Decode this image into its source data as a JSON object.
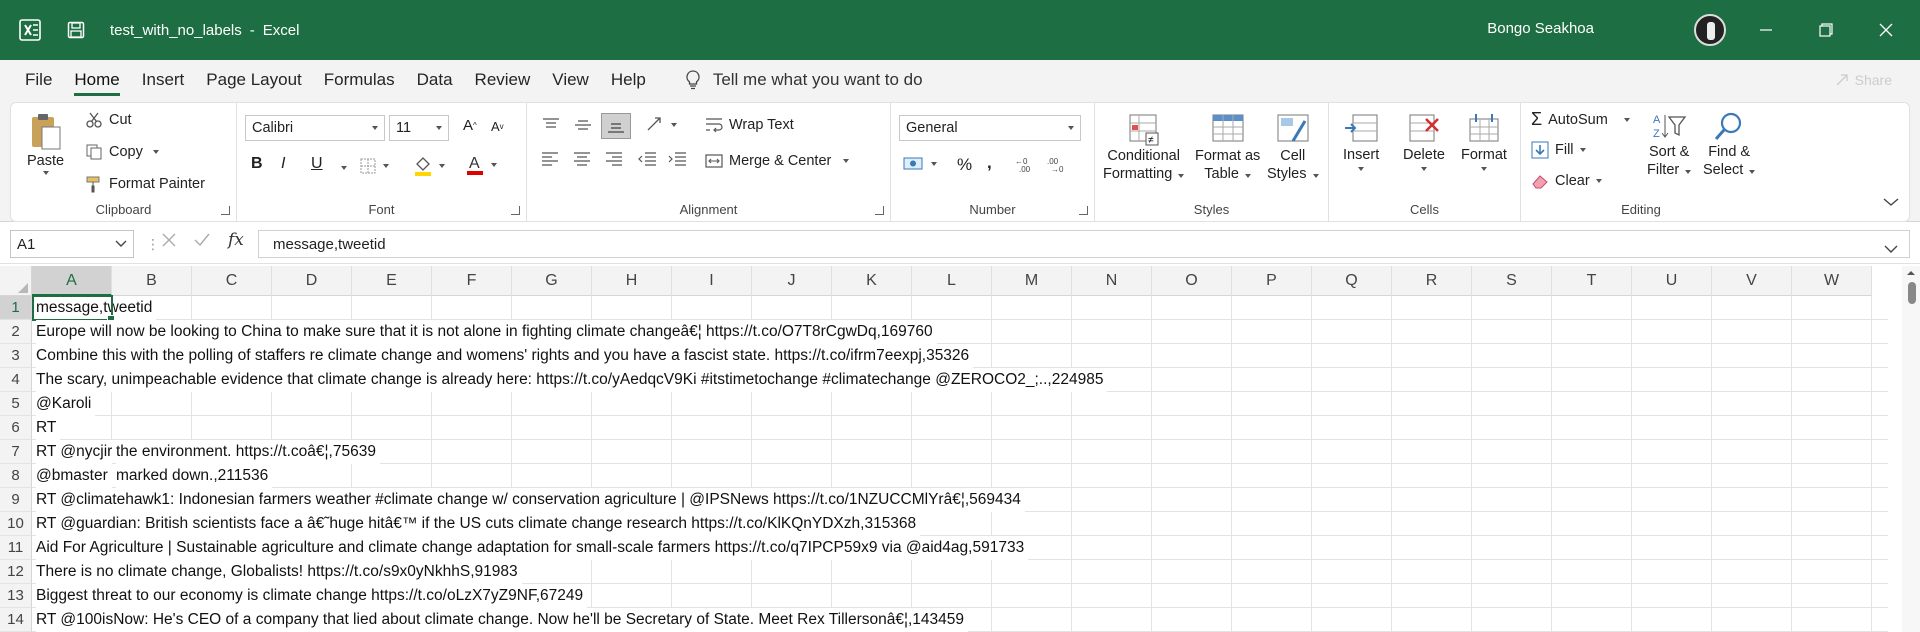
{
  "titlebar": {
    "filename": "test_with_no_labels",
    "separator": "-",
    "app": "Excel",
    "user": "Bongo Seakhoa",
    "brand_color": "#1e6e43"
  },
  "menu": {
    "tabs": [
      "File",
      "Home",
      "Insert",
      "Page Layout",
      "Formulas",
      "Data",
      "Review",
      "View",
      "Help"
    ],
    "active": "Home",
    "tell_me": "Tell me what you want to do",
    "share": "Share"
  },
  "ribbon": {
    "clipboard": {
      "label": "Clipboard",
      "paste": "Paste",
      "cut": "Cut",
      "copy": "Copy",
      "format_painter": "Format Painter"
    },
    "font": {
      "label": "Font",
      "family": "Calibri",
      "size": "11",
      "bold": "B",
      "italic": "I",
      "underline": "U"
    },
    "alignment": {
      "label": "Alignment",
      "wrap": "Wrap Text",
      "merge": "Merge & Center"
    },
    "number": {
      "label": "Number",
      "format": "General",
      "percent": "%",
      "comma": ","
    },
    "styles": {
      "label": "Styles",
      "conditional": [
        "Conditional",
        "Formatting"
      ],
      "format_table": [
        "Format as",
        "Table"
      ],
      "cell_styles": [
        "Cell",
        "Styles"
      ]
    },
    "cells": {
      "label": "Cells",
      "insert": "Insert",
      "delete": "Delete",
      "format": "Format"
    },
    "editing": {
      "label": "Editing",
      "autosum": "AutoSum",
      "fill": "Fill",
      "clear": "Clear",
      "sort": [
        "Sort &",
        "Filter"
      ],
      "find": [
        "Find &",
        "Select"
      ]
    }
  },
  "formula_bar": {
    "name_box": "A1",
    "fx": "fx",
    "content": "message,tweetid"
  },
  "grid": {
    "columns": [
      "A",
      "B",
      "C",
      "D",
      "E",
      "F",
      "G",
      "H",
      "I",
      "J",
      "K",
      "L",
      "M",
      "N",
      "O",
      "P",
      "Q",
      "R",
      "S",
      "T",
      "U",
      "V",
      "W"
    ],
    "selected_column": "A",
    "rows": [
      {
        "n": "1",
        "a": "message,tweetid",
        "b": ""
      },
      {
        "n": "2",
        "a": "Europe will now be looking to China to make sure that it is not alone in fighting climate changeâ€¦ https://t.co/O7T8rCgwDq,169760",
        "b": ""
      },
      {
        "n": "3",
        "a": "Combine this with the polling of staffers re climate change and womens' rights and you have a fascist state. https://t.co/ifrm7eexpj,35326",
        "b": ""
      },
      {
        "n": "4",
        "a": "The scary, unimpeachable evidence that climate change is already here: https://t.co/yAedqcV9Ki #itstimetochange #climatechange @ZEROCO2_;..,224985",
        "b": ""
      },
      {
        "n": "5",
        "a": "@Karoli",
        "b": ""
      },
      {
        "n": "6",
        "a": "RT",
        "b": ""
      },
      {
        "n": "7",
        "a": "RT @nycjir",
        "b": "the environment. https://t.coâ€¦,75639"
      },
      {
        "n": "8",
        "a": "@bmaster",
        "b": "marked down.,211536"
      },
      {
        "n": "9",
        "a": "RT @climatehawk1: Indonesian farmers weather #climate change w/ conservation agriculture | @IPSNews https://t.co/1NZUCCMlYrâ€¦,569434",
        "b": ""
      },
      {
        "n": "10",
        "a": "RT @guardian: British scientists face a â€˜huge hitâ€™ if the US cuts climate change research https://t.co/KlKQnYDXzh,315368",
        "b": ""
      },
      {
        "n": "11",
        "a": "Aid For Agriculture | Sustainable agriculture and climate change adaptation for small-scale farmers https://t.co/q7IPCP59x9 via @aid4ag,591733",
        "b": ""
      },
      {
        "n": "12",
        "a": "There is no climate change, Globalists! https://t.co/s9x0yNkhhS,91983",
        "b": ""
      },
      {
        "n": "13",
        "a": "Biggest threat to our economy is climate change https://t.co/oLzX7yZ9NF,67249",
        "b": ""
      },
      {
        "n": "14",
        "a": "RT @100isNow: He's CEO of a company that lied about climate change. Now he'll be Secretary of State. Meet Rex Tillersonâ€¦,143459",
        "b": ""
      }
    ]
  }
}
